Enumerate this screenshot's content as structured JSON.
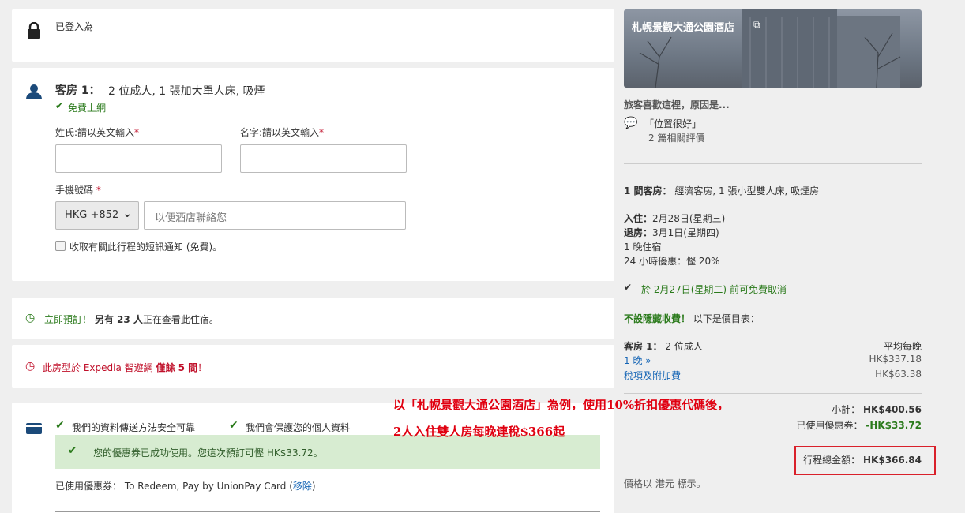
{
  "login": {
    "status": "已登入為"
  },
  "room": {
    "label": "客房 1：",
    "desc": "2 位成人, 1 張加大單人床, 吸煙",
    "wifi": "免費上網",
    "surname_label": "姓氏:請以英文輸入",
    "given_label": "名字:請以英文輸入",
    "phone_label": "手機號碼",
    "country_code": "HKG +852",
    "phone_placeholder": "以便酒店聯絡您",
    "sms_label": "收取有關此行程的短訊通知 (免費)。",
    "required_mark": "*"
  },
  "urgency": {
    "prefix": "立即預訂！",
    "bold": "另有 23 人",
    "suffix": "正在查看此住宿。"
  },
  "scarcity": {
    "prefix": "此房型於 Expedia 智遊網",
    "bold": "僅餘 5 間",
    "suffix": "！"
  },
  "payment": {
    "secure1": "我們的資料傳送方法安全可靠",
    "secure2": "我們會保護您的個人資料",
    "coupon_success": "您的優惠券已成功使用。您這次預訂可慳 HK$33.72。",
    "coupon_used_label": "已使用優惠券：",
    "coupon_name": "To Redeem, Pay by UnionPay Card (",
    "remove": "移除",
    "close_paren": ")"
  },
  "annotation": {
    "line1": "以「札幌景觀大通公園酒店」為例，使用10%折扣優惠代碼後，",
    "line2": "2人入住雙人房每晚連稅$366起"
  },
  "summary": {
    "hotel_name": "札幌景觀大通公園酒店",
    "why_title": "旅客喜歡這裡，原因是...",
    "quote": "「位置很好」",
    "reviews": "2 篇相關評價",
    "rooms_label": "1 間客房：",
    "rooms_desc": "經濟客房, 1 張小型雙人床, 吸煙房",
    "checkin_label": "入住：",
    "checkin": "2月28日(星期三)",
    "checkout_label": "退房：",
    "checkout": "3月1日(星期四)",
    "nights": "1 晚住宿",
    "deal": "24 小時優惠：慳 20%",
    "cancel_prefix": "於",
    "cancel_date": "2月27日(星期二)",
    "cancel_suffix": "前可免費取消",
    "nohidden_bold": "不設隱藏收費！",
    "nohidden_rest": "以下是價目表：",
    "room1_label": "客房 1：",
    "room1_guests": "2 位成人",
    "avg_label": "平均每晚",
    "night_link": "1 晚",
    "night_price": "HK$337.18",
    "tax_link": "稅項及附加費",
    "tax_price": "HK$63.38",
    "subtotal_label": "小計：",
    "subtotal": "HK$400.56",
    "coupon_label": "已使用優惠券：",
    "coupon": "-HK$33.72",
    "total_label": "行程總金額：",
    "total": "HK$366.84",
    "currency_note": "價格以 港元 標示。"
  }
}
